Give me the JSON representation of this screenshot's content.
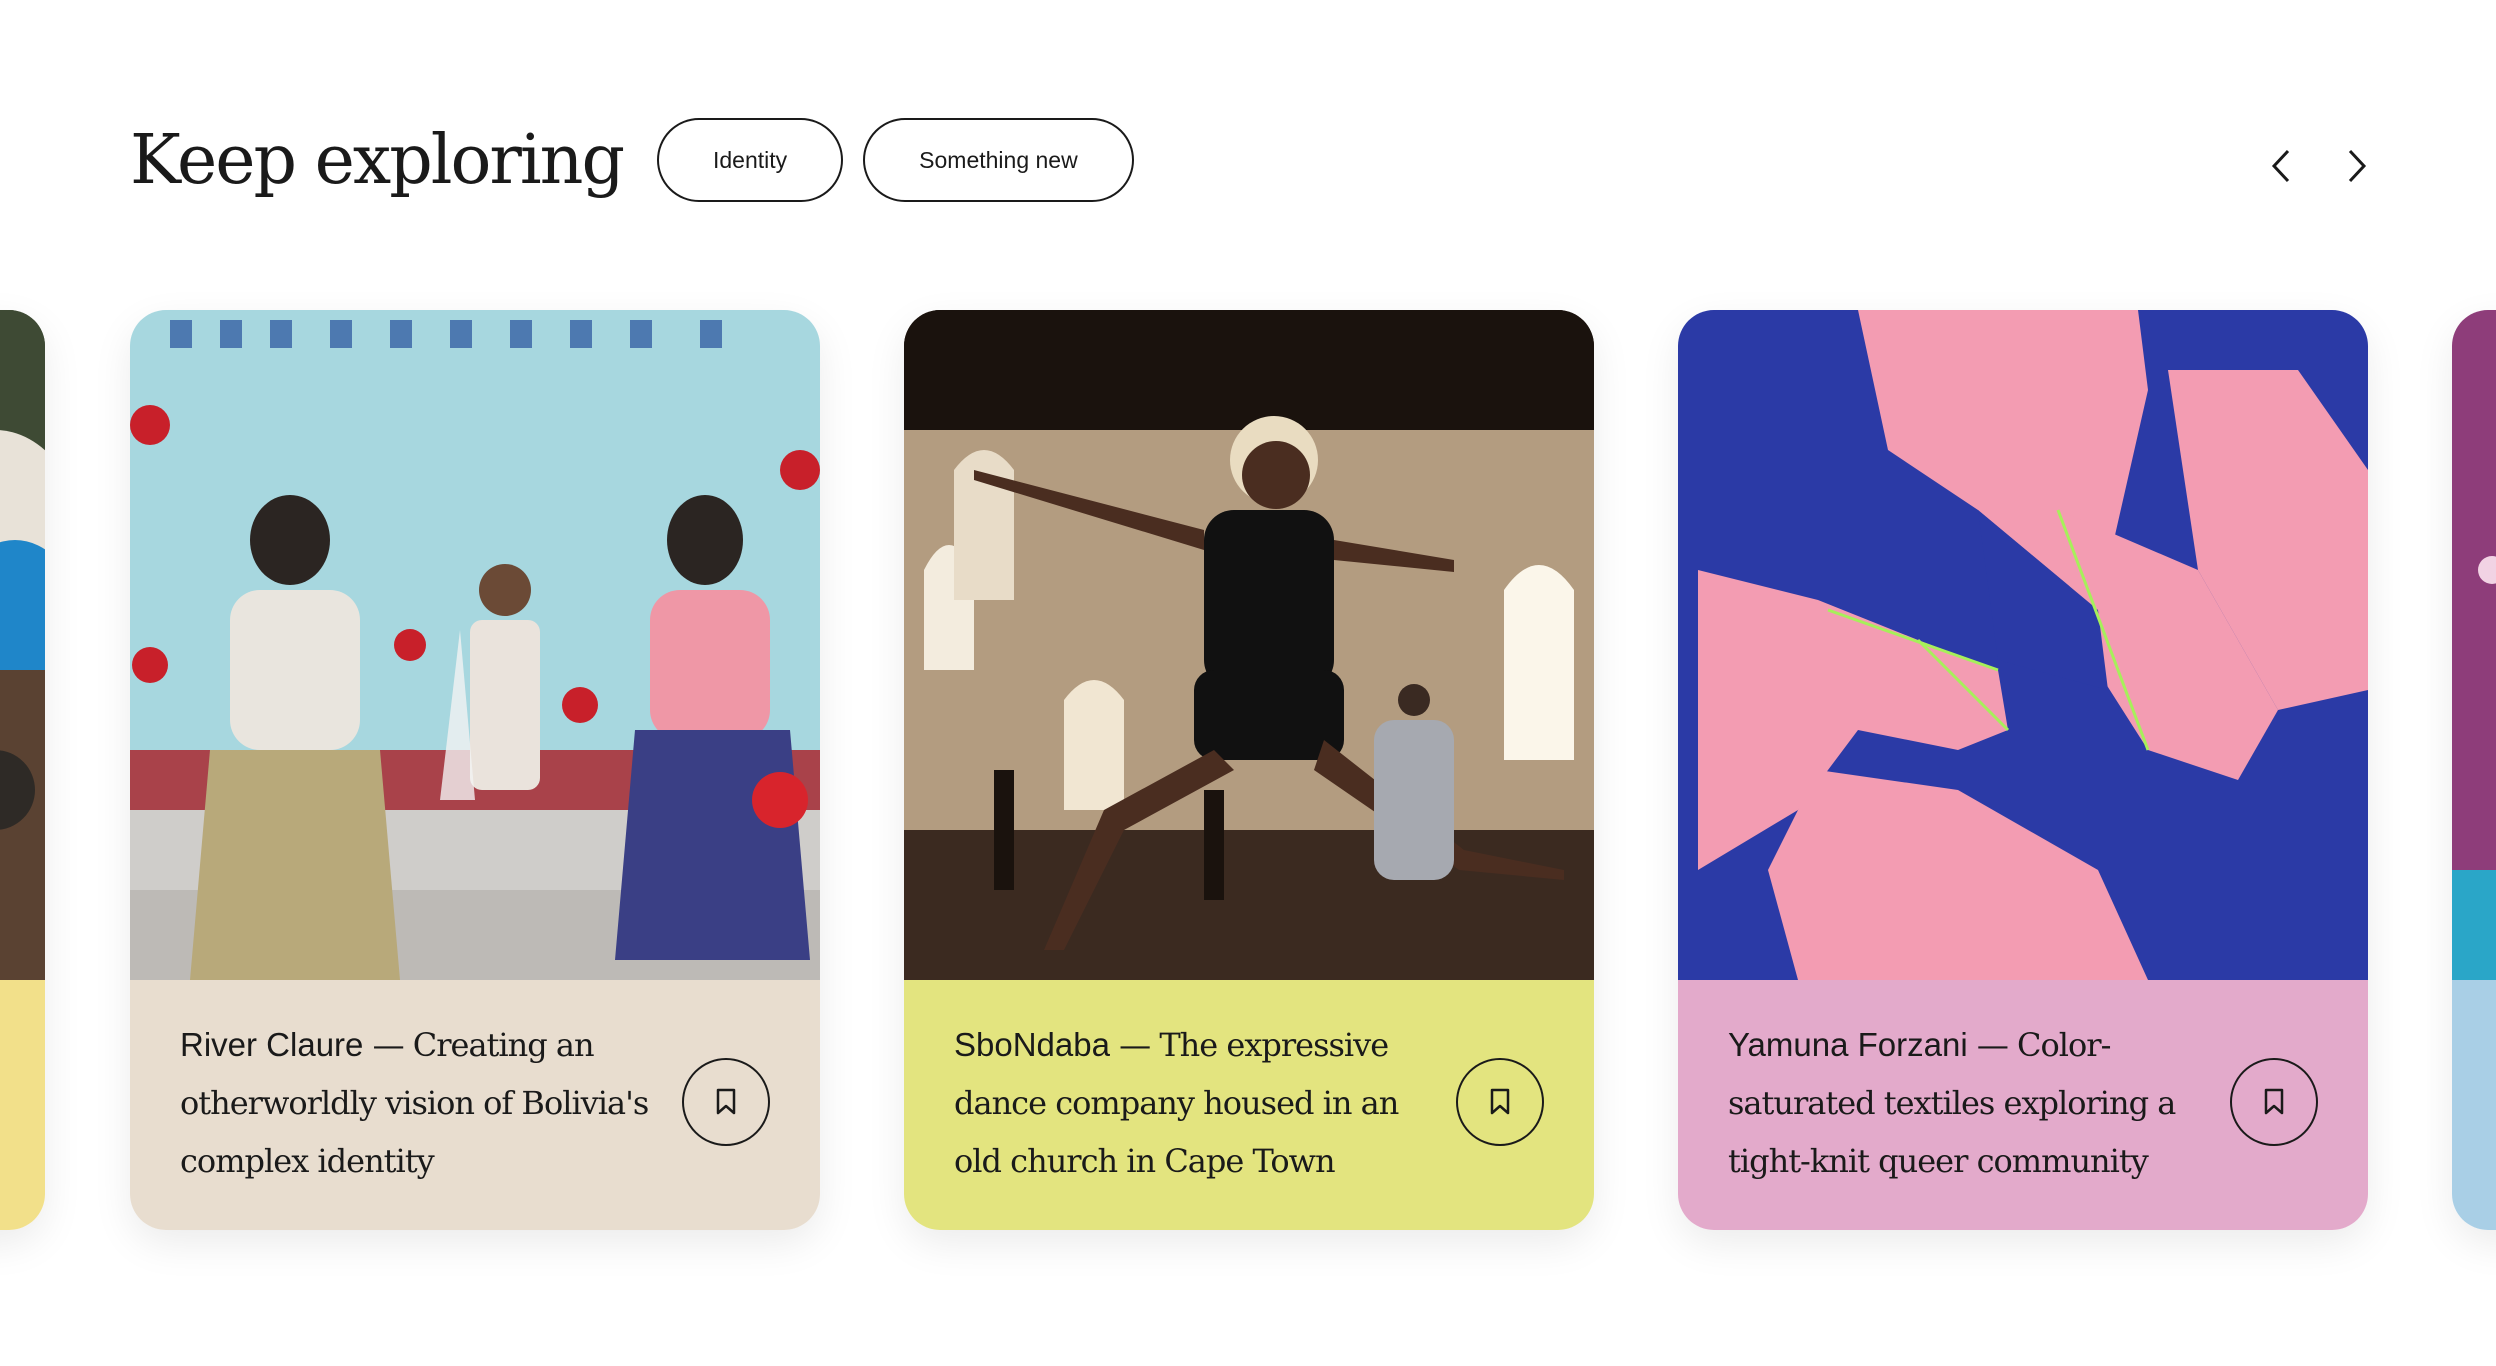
{
  "section": {
    "title": "Keep exploring",
    "filters": [
      "Identity",
      "Something new"
    ]
  },
  "navigation": {
    "prev_icon": "chevron-left-icon",
    "next_icon": "chevron-right-icon"
  },
  "cards": [
    {
      "name": "River Claure",
      "dash": " — ",
      "description": "Creating an otherworldly vision of Bolivia's complex identity",
      "bg_color": "#e8ddcf",
      "bookmark_icon": "bookmark-icon"
    },
    {
      "name": "SboNdaba",
      "dash": " — ",
      "description": "The expressive dance company housed in an old church in Cape Town",
      "bg_color": "#e3e47f",
      "bookmark_icon": "bookmark-icon"
    },
    {
      "name": "Yamuna Forzani",
      "dash": " — ",
      "description": "Color-saturated textiles exploring a tight-knit queer community",
      "bg_color": "#e3aacb",
      "bookmark_icon": "bookmark-icon"
    }
  ],
  "peek_colors": {
    "left": "#f2e08a",
    "right": "#a9cfe6"
  }
}
